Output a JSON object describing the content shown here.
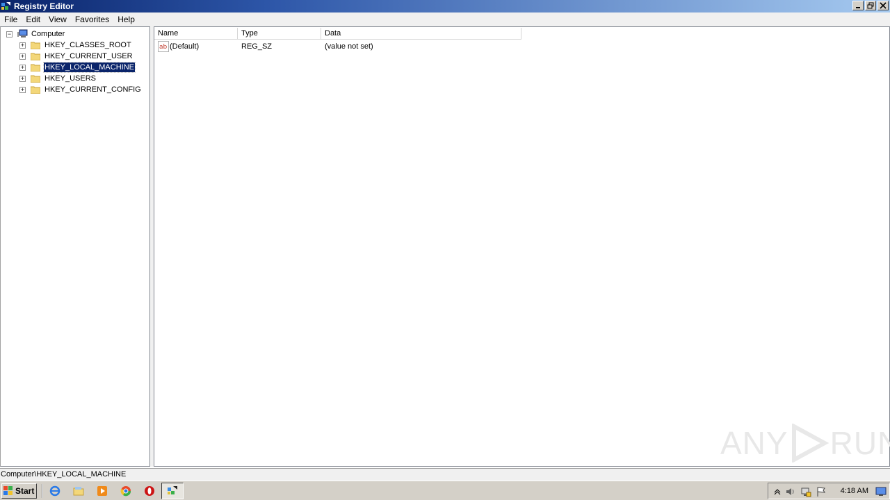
{
  "window": {
    "title": "Registry Editor",
    "controls": [
      "minimize-icon",
      "restore-icon",
      "close-icon"
    ]
  },
  "menu": [
    "File",
    "Edit",
    "View",
    "Favorites",
    "Help"
  ],
  "tree": {
    "root": "Computer",
    "items": [
      {
        "label": "HKEY_CLASSES_ROOT",
        "selected": false
      },
      {
        "label": "HKEY_CURRENT_USER",
        "selected": false
      },
      {
        "label": "HKEY_LOCAL_MACHINE",
        "selected": true
      },
      {
        "label": "HKEY_USERS",
        "selected": false
      },
      {
        "label": "HKEY_CURRENT_CONFIG",
        "selected": false
      }
    ]
  },
  "values": {
    "columns": [
      "Name",
      "Type",
      "Data"
    ],
    "rows": [
      {
        "name": "(Default)",
        "type": "REG_SZ",
        "data": "(value not set)"
      }
    ]
  },
  "statusbar": {
    "path": "Computer\\HKEY_LOCAL_MACHINE"
  },
  "watermark": {
    "text_left": "ANY",
    "text_right": "RUN"
  },
  "taskbar": {
    "start_label": "Start",
    "pinned": [
      "ie-icon",
      "explorer-icon",
      "media-player-icon",
      "chrome-icon",
      "opera-icon",
      "regedit-icon"
    ],
    "clock": "4:18 AM"
  },
  "colors": {
    "selection": "#0a246a",
    "titlebar_start": "#0a246a",
    "titlebar_end": "#a6caf0"
  }
}
